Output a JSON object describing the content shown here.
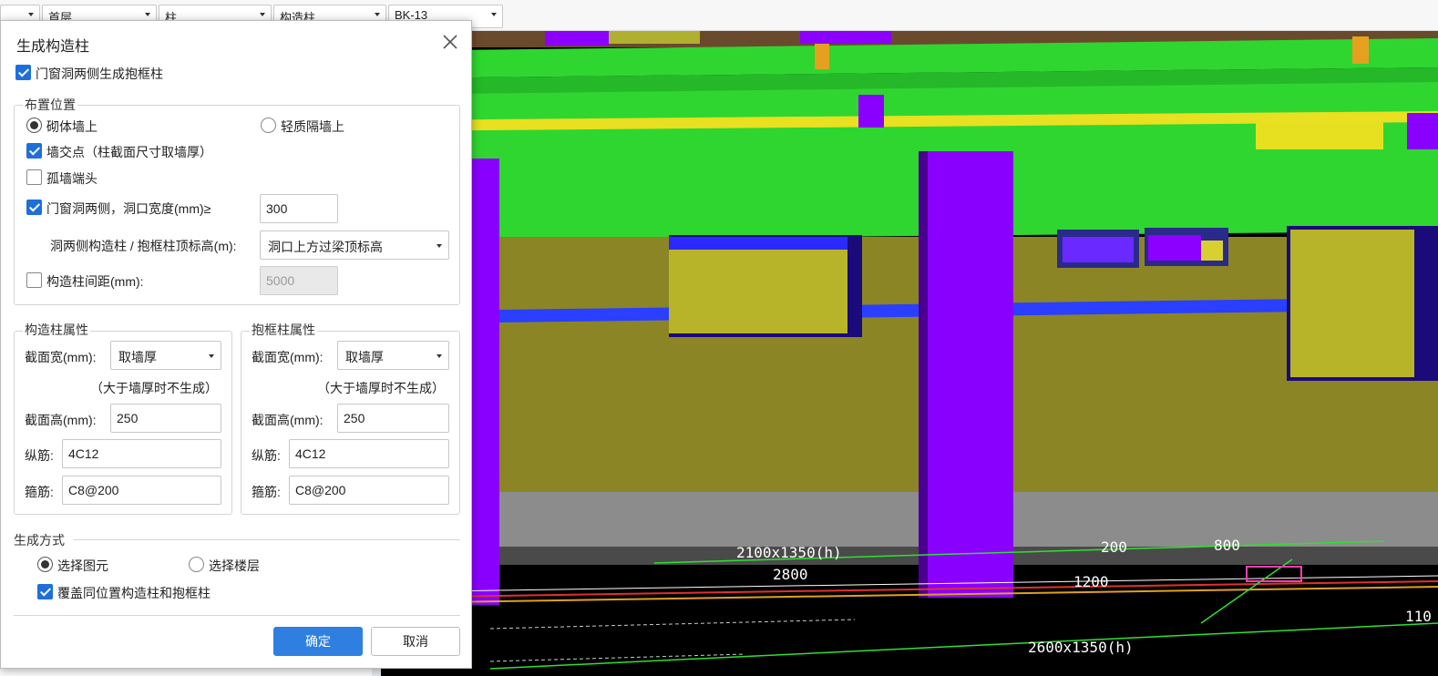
{
  "toolbar": {
    "selects": [
      {
        "value": ""
      },
      {
        "value": "首层"
      },
      {
        "value": "柱"
      },
      {
        "value": "构造柱"
      },
      {
        "value": "BK-13"
      }
    ]
  },
  "dialog": {
    "title": "生成构造柱",
    "door_window_frame_check": "门窗洞两侧生成抱框柱",
    "placement": {
      "title": "布置位置",
      "radio_masonry": "砌体墙上",
      "radio_light": "轻质隔墙上",
      "wall_intersection": "墙交点（柱截面尺寸取墙厚）",
      "isolated_wall_end": "孤墙端头",
      "opening_sides": "门窗洞两侧，洞口宽度(mm)≥",
      "opening_width_value": "300",
      "top_elevation_label": "洞两侧构造柱 / 抱框柱顶标高(m):",
      "top_elevation_value": "洞口上方过梁顶标高",
      "spacing_label": "构造柱间距(mm):",
      "spacing_value": "5000"
    },
    "cons_col": {
      "title": "构造柱属性",
      "width_label": "截面宽(mm):",
      "width_value": "取墙厚",
      "note": "（大于墙厚时不生成）",
      "height_label": "截面高(mm):",
      "height_value": "250",
      "long_bar_label": "纵筋:",
      "long_bar_value": "4C12",
      "stirrup_label": "箍筋:",
      "stirrup_value": "C8@200"
    },
    "frame_col": {
      "title": "抱框柱属性",
      "width_label": "截面宽(mm):",
      "width_value": "取墙厚",
      "note": "（大于墙厚时不生成）",
      "height_label": "截面高(mm):",
      "height_value": "250",
      "long_bar_label": "纵筋:",
      "long_bar_value": "4C12",
      "stirrup_label": "箍筋:",
      "stirrup_value": "C8@200"
    },
    "gen_mode": {
      "title": "生成方式",
      "radio_element": "选择图元",
      "radio_floor": "选择楼层",
      "overwrite": "覆盖同位置构造柱和抱框柱"
    },
    "ok": "确定",
    "cancel": "取消"
  },
  "cad_text": {
    "t1": "2100x1350(h)",
    "t2": "2800",
    "t3": "200",
    "t4": "800",
    "t5": "1200",
    "t6": "2600x1350(h)",
    "t7": "110"
  },
  "colors": {
    "beam_green": "#2fd630",
    "column_purple": "#8a00ff",
    "wall_olive": "#8c8526",
    "window_yellow": "#b8b42a",
    "pipe_blue": "#2a3fff",
    "primary_button": "#2f7fe0"
  }
}
